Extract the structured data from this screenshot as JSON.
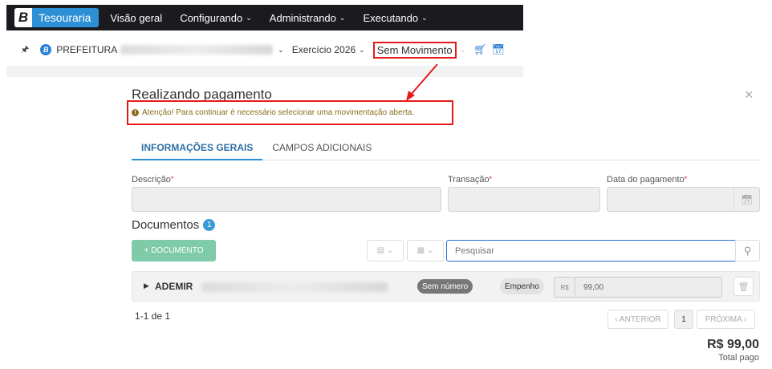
{
  "app": {
    "brand_letter": "B",
    "brand_name": "Tesouraria"
  },
  "nav": {
    "items": [
      {
        "label": "Visão geral",
        "caret": ""
      },
      {
        "label": "Configurando",
        "caret": "⌄"
      },
      {
        "label": "Administrando",
        "caret": "⌄"
      },
      {
        "label": "Executando",
        "caret": "⌄"
      }
    ]
  },
  "context": {
    "pin_icon": "pin-icon",
    "org_letter": "B",
    "org_name": "PREFEITURA",
    "exercise": "Exercício 2026",
    "movement": "Sem Movimento",
    "caret": "⌄",
    "cart_icon": "cart-icon",
    "calendar_icon": "calendar-icon"
  },
  "modal": {
    "title": "Realizando pagamento",
    "close": "×",
    "alert_icon": "!",
    "alert": "Atenção! Para continuar é necessário selecionar uma movimentação aberta.",
    "tabs": [
      "INFORMAÇÕES GERAIS",
      "CAMPOS ADICIONAIS"
    ],
    "fields": {
      "descricao": "Descrição",
      "transacao": "Transação",
      "data_pagamento": "Data do pagamento",
      "required_mark": "*"
    },
    "documents": {
      "title": "Documentos",
      "count": "1",
      "add_button": "+ DOCUMENTO",
      "search_placeholder": "Pesquisar",
      "rows": [
        {
          "name": "ADEMIR",
          "number_tag": "Sem número",
          "type_tag": "Empenho",
          "currency": "R$",
          "value": "99,00"
        }
      ]
    },
    "pagination": {
      "info": "1-1 de 1",
      "prev": "‹ ANTERIOR",
      "page": "1",
      "next": "PRÓXIMA ›"
    },
    "total": {
      "value": "R$ 99,00",
      "label": "Total pago"
    }
  },
  "colors": {
    "accent": "#2d8fd5",
    "highlight": "#e41a1a",
    "nav_bg": "#1a1a1f",
    "add_button": "#7fcba9"
  }
}
